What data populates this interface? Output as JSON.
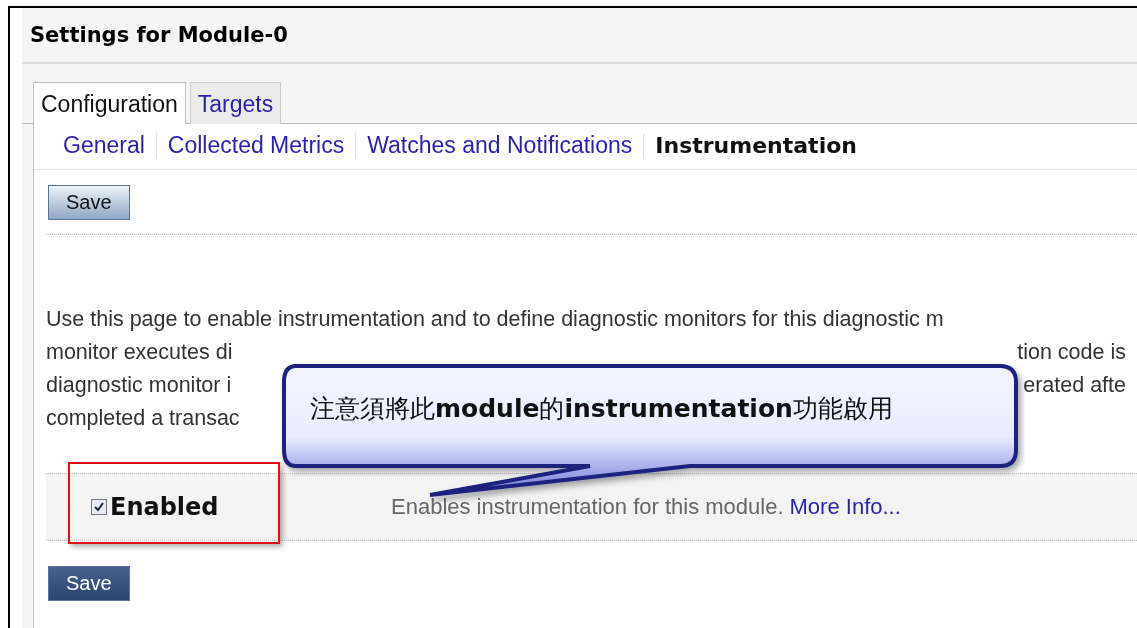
{
  "title": "Settings for Module-0",
  "tabs": [
    {
      "label": "Configuration",
      "selected": true
    },
    {
      "label": "Targets",
      "selected": false
    }
  ],
  "subtabs": [
    {
      "label": "General",
      "selected": false
    },
    {
      "label": "Collected Metrics",
      "selected": false
    },
    {
      "label": "Watches and Notifications",
      "selected": false
    },
    {
      "label": "Instrumentation",
      "selected": true
    }
  ],
  "buttons": [
    {
      "label": "Save",
      "kind": "plain"
    },
    {
      "label": "Save",
      "kind": "dark"
    }
  ],
  "description_lines": [
    {
      "left": "Use this page to enable instrumentation and to define diagnostic monitors for this diagnostic m"
    },
    {
      "left": "monitor executes di",
      "right": "tion code is"
    },
    {
      "left": "diagnostic monitor i",
      "right": "erated afte"
    },
    {
      "left": "completed a transac"
    }
  ],
  "callout": {
    "text": "注意須將此**module**的**instrumentation**功能啟用"
  },
  "setting": {
    "label": "Enabled",
    "checked": true,
    "highlighted": true,
    "help": "Enables instrumentation for this module.",
    "link": "More Info..."
  }
}
